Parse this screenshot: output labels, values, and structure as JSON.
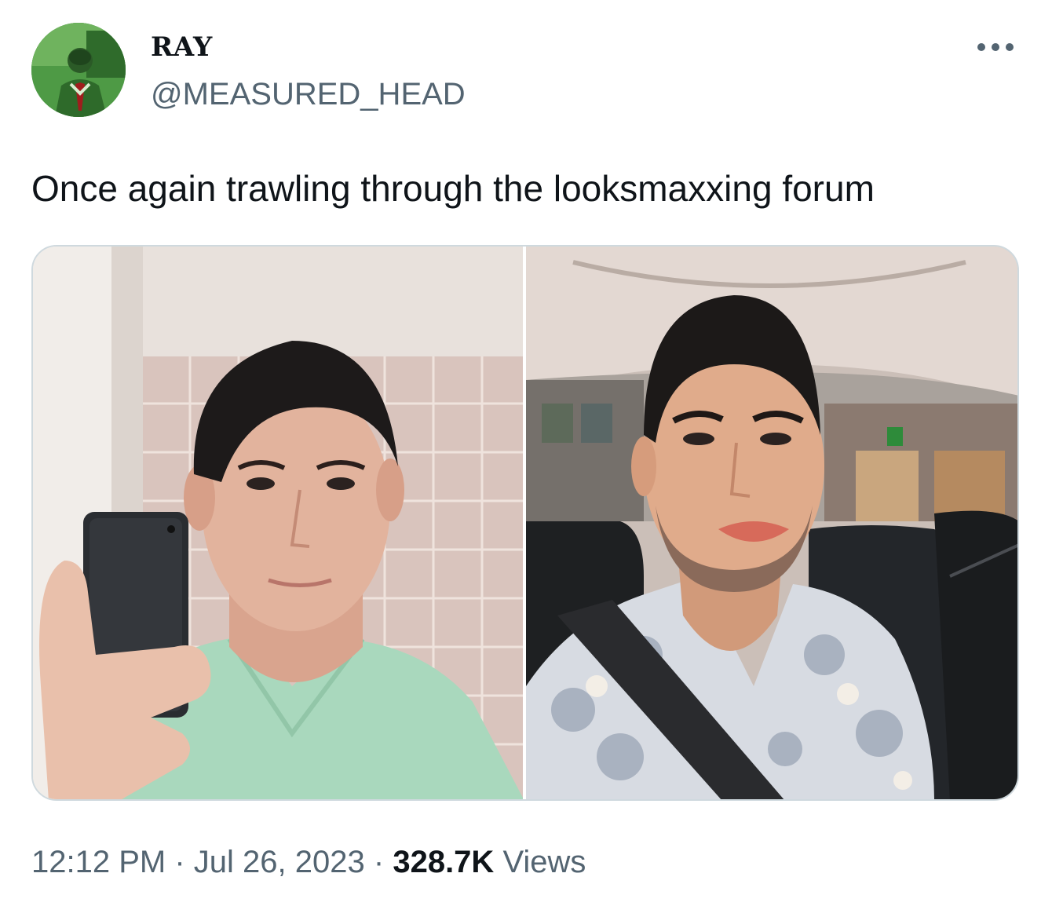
{
  "author": {
    "display_name": "RAY",
    "handle": "@MEASURED_HEAD"
  },
  "tweet": {
    "text": "Once again trawling through the looksmaxxing forum"
  },
  "meta": {
    "time": "12:12 PM",
    "separator": "·",
    "date": "Jul 26, 2023",
    "views_count": "328.7K",
    "views_label": "Views"
  },
  "icons": {
    "more": "more-horizontal-icon"
  },
  "colors": {
    "text_primary": "#0f1419",
    "text_secondary": "#536471",
    "border": "#cfd9de",
    "avatar_tint": "#3f8f3c"
  }
}
